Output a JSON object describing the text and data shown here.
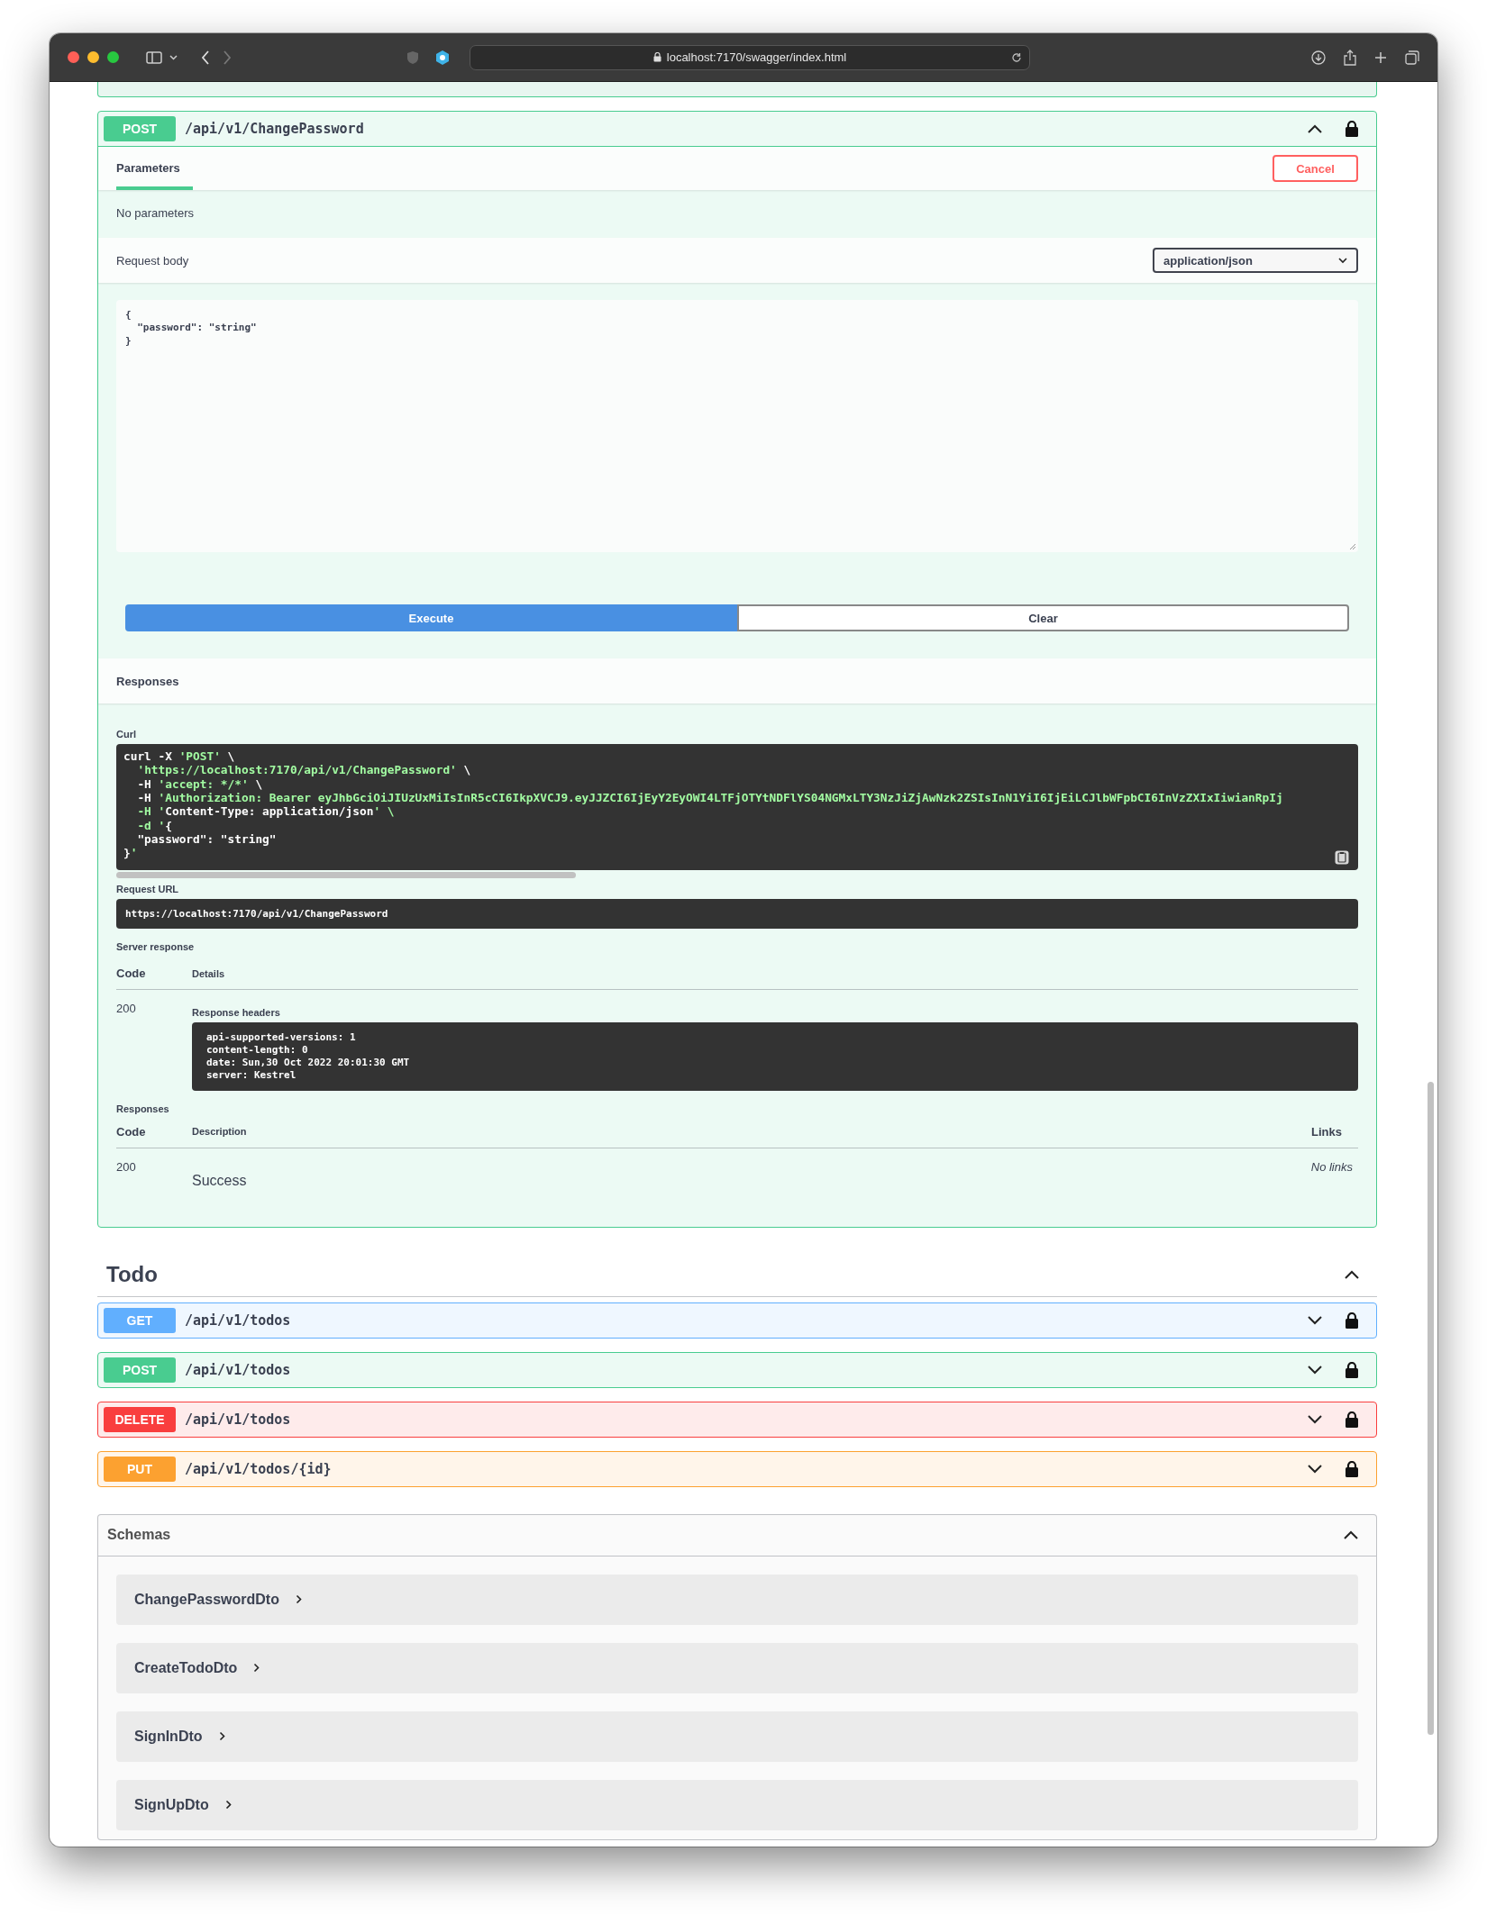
{
  "browser": {
    "url": "localhost:7170/swagger/index.html"
  },
  "operation": {
    "method": "POST",
    "color": "#49cc90",
    "path": "/api/v1/ChangePassword",
    "expanded": true,
    "tabs": [
      {
        "label": "Parameters",
        "selected": true
      }
    ],
    "cancel_button": "Cancel",
    "parameters_note": "No parameters",
    "request_body_label": "Request body",
    "content_type": "application/json",
    "request_body": "{\n  \"password\": \"string\"\n}",
    "buttons": [
      {
        "label": "Execute",
        "kind": "primary"
      },
      {
        "label": "Clear",
        "kind": "secondary"
      }
    ],
    "responses_heading": "Responses",
    "curl": {
      "label": "Curl",
      "code": "curl -X 'POST' \\\n  'https://localhost:7170/api/v1/ChangePassword' \\\n  -H 'accept: */*' \\\n  -H 'Authorization: Bearer eyJhbGciOiJIUzUxMiIsInR5cCI6IkpXVCJ9.eyJJZCI6IjEyY2EyOWI4LTFjOTYtNDFlYS04NGMxLTY3NzJiZjAwNzk2ZSIsInN1YiI6IjEiLCJlbWFpbCI6InVzZXIxIiwianRpIj\n  -H 'Content-Type: application/json' \\\n  -d '{\n  \"password\": \"string\"\n}'"
    },
    "request_url": {
      "label": "Request URL",
      "value": "https://localhost:7170/api/v1/ChangePassword"
    },
    "server_response": {
      "label": "Server response",
      "columns": [
        "Code",
        "Details"
      ],
      "code": "200",
      "headers_label": "Response headers",
      "headers": "api-supported-versions: 1\ncontent-length: 0\ndate: Sun,30 Oct 2022 20:01:30 GMT\nserver: Kestrel"
    },
    "responses": {
      "label": "Responses",
      "columns": [
        "Code",
        "Description",
        "Links"
      ],
      "rows": [
        {
          "code": "200",
          "description": "Success",
          "links": "No links"
        }
      ]
    }
  },
  "sections": [
    {
      "title": "Todo",
      "expanded": true,
      "operations": [
        {
          "method": "GET",
          "color": "#61affe",
          "path": "/api/v1/todos",
          "expanded": false
        },
        {
          "method": "POST",
          "color": "#49cc90",
          "path": "/api/v1/todos",
          "expanded": false
        },
        {
          "method": "DELETE",
          "color": "#f93e3e",
          "path": "/api/v1/todos",
          "expanded": false
        },
        {
          "method": "PUT",
          "color": "#fca130",
          "path": "/api/v1/todos/{id}",
          "expanded": false
        }
      ]
    }
  ],
  "schemas": {
    "title": "Schemas",
    "expanded": true,
    "items": [
      {
        "name": "ChangePasswordDto",
        "expanded": false
      },
      {
        "name": "CreateTodoDto",
        "expanded": false
      },
      {
        "name": "SignInDto",
        "expanded": false
      },
      {
        "name": "SignUpDto",
        "expanded": false
      }
    ]
  }
}
